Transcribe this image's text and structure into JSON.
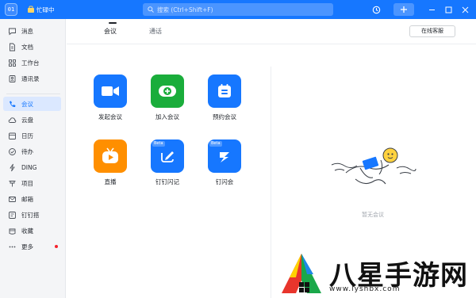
{
  "titlebar": {
    "avatar_text": "01",
    "status_text": "忙碌中",
    "search_placeholder": "搜索 (Ctrl+Shift+F)",
    "accent_color": "#1677ff",
    "icons": [
      "history-icon",
      "plus-icon",
      "minimize-icon",
      "maximize-icon",
      "close-icon"
    ]
  },
  "sidebar": {
    "items": [
      {
        "label": "消息",
        "icon": "message-icon"
      },
      {
        "label": "文档",
        "icon": "document-icon"
      },
      {
        "label": "工作台",
        "icon": "workbench-icon"
      },
      {
        "label": "通讯录",
        "icon": "contacts-icon"
      },
      {
        "label": "会议",
        "icon": "phone-icon",
        "active": true
      },
      {
        "label": "云盘",
        "icon": "cloud-icon"
      },
      {
        "label": "日历",
        "icon": "calendar-icon"
      },
      {
        "label": "待办",
        "icon": "todo-icon"
      },
      {
        "label": "DING",
        "icon": "ding-icon"
      },
      {
        "label": "项目",
        "icon": "project-icon"
      },
      {
        "label": "邮箱",
        "icon": "mail-icon"
      },
      {
        "label": "钉钉搭",
        "icon": "builder-icon"
      },
      {
        "label": "收藏",
        "icon": "favorite-icon"
      },
      {
        "label": "更多",
        "icon": "more-icon",
        "badge": "red-dot"
      }
    ]
  },
  "main": {
    "tabs": [
      {
        "label": "会议",
        "active": true
      },
      {
        "label": "通话"
      }
    ],
    "archive_button": "在线客服",
    "apps": [
      {
        "label": "发起会议",
        "icon": "video-camera-icon",
        "color": "#1677ff"
      },
      {
        "label": "加入会议",
        "icon": "join-plus-icon",
        "color": "#1aad3b"
      },
      {
        "label": "预约会议",
        "icon": "schedule-calendar-icon",
        "color": "#1677ff"
      },
      {
        "label": "直播",
        "icon": "live-tv-icon",
        "color": "#ff8f00"
      },
      {
        "label": "钉钉闪记",
        "icon": "flash-note-icon",
        "color": "#1677ff",
        "badge": "Beta"
      },
      {
        "label": "钉闪会",
        "icon": "flash-meeting-icon",
        "color": "#1677ff",
        "badge": "Beta"
      }
    ],
    "empty_state": "暂无会议"
  },
  "watermark": {
    "title": "八星手游网",
    "url": "www.lyshbx.com"
  }
}
